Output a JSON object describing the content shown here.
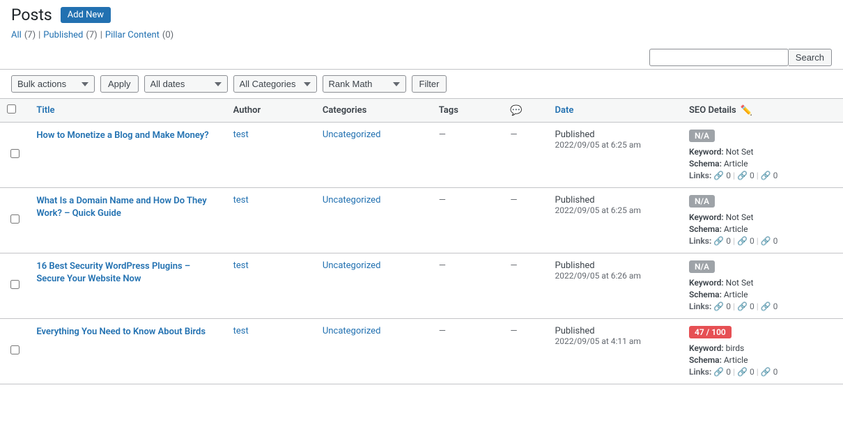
{
  "page": {
    "title": "Posts",
    "add_new_label": "Add New"
  },
  "subnav": {
    "all_label": "All",
    "all_count": "(7)",
    "published_label": "Published",
    "published_count": "(7)",
    "pillar_label": "Pillar Content",
    "pillar_count": "(0)"
  },
  "search": {
    "placeholder": "",
    "button_label": "Search"
  },
  "toolbar": {
    "bulk_actions_label": "Bulk actions",
    "apply_label": "Apply",
    "all_dates_label": "All dates",
    "all_categories_label": "All Categories",
    "rank_math_label": "Rank Math",
    "filter_label": "Filter"
  },
  "table": {
    "headers": {
      "title": "Title",
      "author": "Author",
      "categories": "Categories",
      "tags": "Tags",
      "comments": "💬",
      "date": "Date",
      "seo": "SEO Details"
    },
    "rows": [
      {
        "id": 1,
        "title": "How to Monetize a Blog and Make Money?",
        "author": "test",
        "categories": "Uncategorized",
        "tags": "—",
        "comments": "—",
        "date_status": "Published",
        "date_value": "2022/09/05 at 6:25 am",
        "seo_score": "N/A",
        "seo_score_type": "na",
        "keyword_label": "Keyword:",
        "keyword_value": "Not Set",
        "schema_label": "Schema:",
        "schema_value": "Article",
        "links_label": "Links:",
        "links_internal": "0",
        "links_external": "0",
        "links_affiliate": "0"
      },
      {
        "id": 2,
        "title": "What Is a Domain Name and How Do They Work? – Quick Guide",
        "author": "test",
        "categories": "Uncategorized",
        "tags": "—",
        "comments": "—",
        "date_status": "Published",
        "date_value": "2022/09/05 at 6:25 am",
        "seo_score": "N/A",
        "seo_score_type": "na",
        "keyword_label": "Keyword:",
        "keyword_value": "Not Set",
        "schema_label": "Schema:",
        "schema_value": "Article",
        "links_label": "Links:",
        "links_internal": "0",
        "links_external": "0",
        "links_affiliate": "0"
      },
      {
        "id": 3,
        "title": "16 Best Security WordPress Plugins – Secure Your Website Now",
        "author": "test",
        "categories": "Uncategorized",
        "tags": "—",
        "comments": "—",
        "date_status": "Published",
        "date_value": "2022/09/05 at 6:26 am",
        "seo_score": "N/A",
        "seo_score_type": "na",
        "keyword_label": "Keyword:",
        "keyword_value": "Not Set",
        "schema_label": "Schema:",
        "schema_value": "Article",
        "links_label": "Links:",
        "links_internal": "0",
        "links_external": "0",
        "links_affiliate": "0"
      },
      {
        "id": 4,
        "title": "Everything You Need to Know About Birds",
        "author": "test",
        "categories": "Uncategorized",
        "tags": "—",
        "comments": "—",
        "date_status": "Published",
        "date_value": "2022/09/05 at 4:11 am",
        "seo_score": "47 / 100",
        "seo_score_type": "red",
        "keyword_label": "Keyword:",
        "keyword_value": "birds",
        "schema_label": "Schema:",
        "schema_value": "Article",
        "links_label": "Links:",
        "links_internal": "0",
        "links_external": "0",
        "links_affiliate": "0"
      }
    ]
  }
}
